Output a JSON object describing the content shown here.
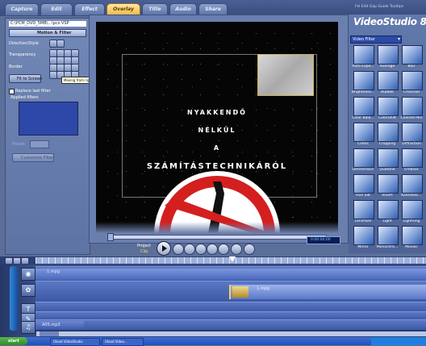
{
  "tabs": [
    "Capture",
    "Edit",
    "Effect",
    "Overlay",
    "Title",
    "Audio",
    "Share"
  ],
  "active_tab": "Overlay",
  "top_right_text": "Fel Edit Gap Guide Tooltips",
  "app_title": "VideoStudio 8",
  "left_panel": {
    "file_path": "C:\\PCM_DVD_5MB\\...\\pcs VSP",
    "section_title": "Motion & Filter",
    "direction_style_label": "Direction/Style",
    "transparency_label": "Transparency",
    "border_label": "Border",
    "fit_to_screen": "Fit to Screen",
    "replace_last_filter": "Replace last filter",
    "applied_filters": "Applied filters",
    "preset_label": "Preset",
    "customize_filter": "Customize Filter",
    "tooltip": "Moving from right to left, starting at screen and ending off screen"
  },
  "preview": {
    "lines": [
      "NYAKKENDŐ",
      "NÉLKÜL",
      "A",
      "SZÁMÍTÁSTECHNIKÁRÓL"
    ],
    "project_label": "Project",
    "clip_label": "Clip",
    "timecode": "0:00:00:00"
  },
  "filter_dropdown": "Video Filter",
  "filters": [
    "Auto Expo...",
    "Average",
    "Blur",
    "Brightness...",
    "Bubble",
    "Charcoal",
    "Color Bala...",
    "ColorShift",
    "Colored Pen",
    "Comic",
    "Cropping",
    "Diffraction",
    "DeInterlace",
    "Duotone",
    "Emboss",
    "Hue Sat",
    "Invert",
    "Kaleidosc...",
    "Lensflare",
    "Light",
    "Lightning",
    "Mirror",
    "Monochro...",
    "Mosaic"
  ],
  "timeline": {
    "video_clip": "1.mpg",
    "overlay_clip": "1.mpg",
    "audio_clip": "A05.mp3"
  },
  "taskbar": {
    "start": "start",
    "item1": "Ulead VideoStudio",
    "item2": "Ulead Video..."
  }
}
